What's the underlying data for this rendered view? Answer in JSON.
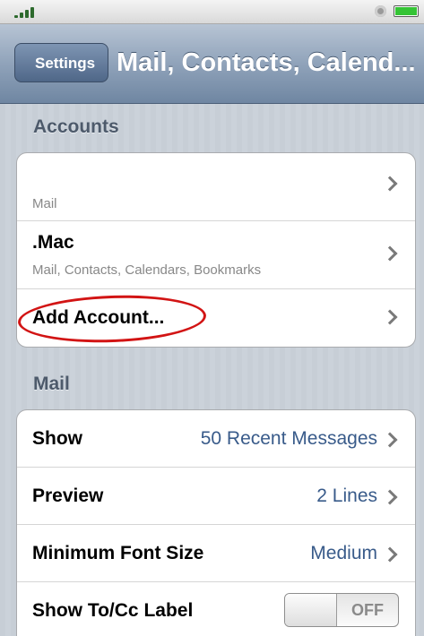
{
  "status_bar": {
    "signal_icon": "signal-bars-icon",
    "sync_icon": "sync-icon",
    "battery_icon": "battery-icon",
    "battery_color": "#35c435"
  },
  "nav": {
    "back_label": "Settings",
    "title": "Mail, Contacts, Calend..."
  },
  "accounts": {
    "header": "Accounts",
    "rows": [
      {
        "title": "",
        "subtitle": "Mail"
      },
      {
        "title": ".Mac",
        "subtitle": "Mail, Contacts, Calendars, Bookmarks"
      },
      {
        "title": "Add Account..."
      }
    ]
  },
  "mail": {
    "header": "Mail",
    "rows": [
      {
        "label": "Show",
        "value": "50 Recent Messages"
      },
      {
        "label": "Preview",
        "value": "2 Lines"
      },
      {
        "label": "Minimum Font Size",
        "value": "Medium"
      },
      {
        "label": "Show To/Cc Label",
        "toggle": "OFF"
      }
    ]
  },
  "colors": {
    "nav_tint": "#6f86a2",
    "value_text": "#395b8a",
    "annotation": "#d21414"
  }
}
